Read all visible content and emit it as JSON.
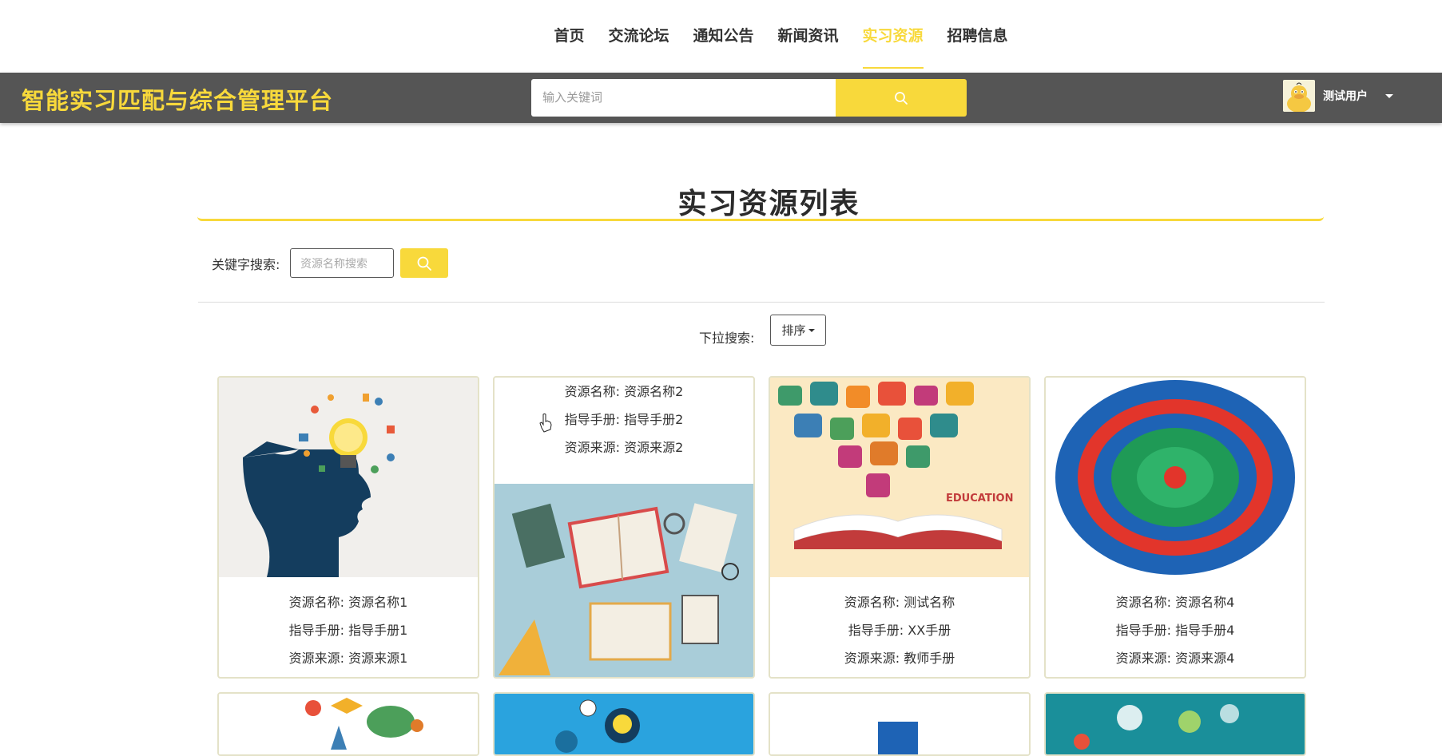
{
  "nav": {
    "items": [
      {
        "label": "首页",
        "active": false
      },
      {
        "label": "交流论坛",
        "active": false
      },
      {
        "label": "通知公告",
        "active": false
      },
      {
        "label": "新闻资讯",
        "active": false
      },
      {
        "label": "实习资源",
        "active": true
      },
      {
        "label": "招聘信息",
        "active": false
      }
    ]
  },
  "header": {
    "site_title": "智能实习匹配与综合管理平台",
    "search_placeholder": "输入关键词",
    "search_icon": "search-icon",
    "user_name": "测试用户"
  },
  "main": {
    "title": "实习资源列表",
    "keyword_label": "关键字搜索:",
    "keyword_placeholder": "资源名称搜索",
    "dropdown_label": "下拉搜索:",
    "sort_label": "排序"
  },
  "field_labels": {
    "name": "资源名称:",
    "manual": "指导手册:",
    "source": "资源来源:"
  },
  "cards": [
    {
      "name": "资源名称1",
      "manual": "指导手册1",
      "source": "资源来源1",
      "image": "head-lightbulb-illustration"
    },
    {
      "name": "资源名称2",
      "manual": "指导手册2",
      "source": "资源来源2",
      "image": "books-desk-illustration"
    },
    {
      "name": "测试名称",
      "manual": "XX手册",
      "source": "教师手册",
      "image": "education-book-illustration"
    },
    {
      "name": "资源名称4",
      "manual": "指导手册4",
      "source": "资源来源4",
      "image": "skills-circle-diagram"
    }
  ],
  "colors": {
    "accent": "#f8d93b",
    "header_bg": "#555555"
  }
}
